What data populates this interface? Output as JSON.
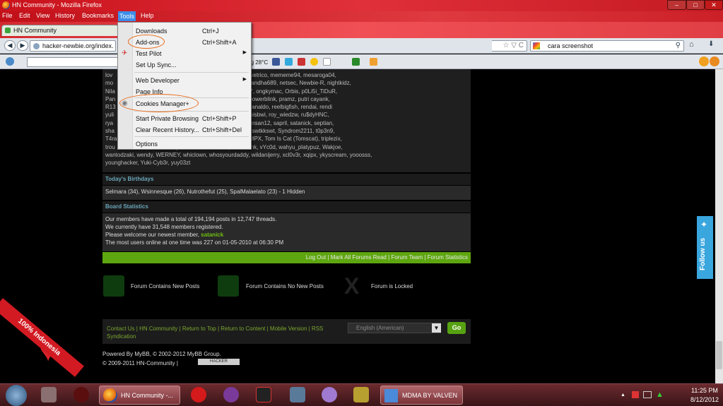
{
  "window": {
    "title": "HN Community - Mozilla Firefox",
    "min": "–",
    "max": "□",
    "close": "✕"
  },
  "menubar": [
    "File",
    "Edit",
    "View",
    "History",
    "Bookmarks",
    "Tools",
    "Help"
  ],
  "tab": {
    "label": "HN Community",
    "close": "×"
  },
  "navbar": {
    "back": "◀",
    "forward": "▶",
    "url": "hacker-newbie.org/index.",
    "star": "☆ ▽ C",
    "search_value": "cara screenshot",
    "search_icon": "search-icon"
  },
  "toolbar2": {
    "weather": "rang 28°C"
  },
  "tools_menu": {
    "items": [
      {
        "label": "Downloads",
        "shortcut": "Ctrl+J"
      },
      {
        "label": "Add-ons",
        "shortcut": "Ctrl+Shift+A"
      },
      {
        "label": "Test Pilot",
        "shortcut": ""
      },
      {
        "label": "Set Up Sync...",
        "shortcut": ""
      },
      {
        "label": "Web Developer",
        "shortcut": ""
      },
      {
        "label": "Page Info",
        "shortcut": ""
      },
      {
        "label": "Cookies Manager+",
        "shortcut": ""
      },
      {
        "label": "Start Private Browsing",
        "shortcut": "Ctrl+Shift+P"
      },
      {
        "label": "Clear Recent History...",
        "shortcut": "Ctrl+Shift+Del"
      },
      {
        "label": "Options",
        "shortcut": ""
      }
    ],
    "submenu_arrow": "▶"
  },
  "online_users": [
    "lov                                        3X, madnun, maknasetya, mavetrico, mememe94, mesaroga04,",
    "mo                                         _c0d3, N@wbie, nackkecil, Nandha689, netsec, Newbie-R, nightkidz,",
    "Nila                                       OB-PP, ochysudiqdo, oka1307, ongkymac, Orbis, p0Li5i_TiDuR,",
    "Pan                                ker, phiA, phikox, piuzz, plashtix, powerblink, pramz, putri cayank,",
    "R13                                       to, Random00, ravi, rawie, Reanaldo, reelbigfish, rendai, rendi",
    "yuli                                  cufky-XFL, rin.cruzer, RockSyd, roisbwi, roy_wiedzw, ru$dyHNC,",
    "rya                                   yuz4k1, SANG_KERINDUAN, Sansan12, sapril, satanick, septian,",
    "sha                                     oheLz, stronghold, SuperR00T, swtkkswt, Syndrom2211, t0p3n9,",
    "T4ra                                thedanielaaa95, TheGreenzzz, TMPX, Tom Is Cat (Tomscat), triplezix,",
    "trou                                  Virgin, volcalesia, vrobby46, vvtonk, vYc0d, wahyu_platypuz, Wakjoe,",
    "wantodzaki, wendy, WERNEY, whiclown, whosyourdaddy, wildanijerry, xcl0v3r, xqipx, ykyscream, yooosss,",
    "younghacker, Yuki-Cyb3r, yuy03zt"
  ],
  "birthdays": {
    "heading": "Today's Birthdays",
    "row": "Selmara (34), Wsinnesque (26), Nutrothefut (25), SpalMalaelato (23) - 1 Hidden"
  },
  "stats": {
    "heading": "Board Statistics",
    "line1": "Our members have made a total of 194,194 posts in 12,747 threads.",
    "line2": "We currently have 31,548 members registered.",
    "line3_prefix": "Please welcome our newest member, ",
    "line3_member": "satanick",
    "line4": "The most users online at one time was 227 on 01-05-2010 at 06:30 PM"
  },
  "footbar": "Log Out | Mark All Forums Read | Forum Team | Forum Statistics",
  "legend": {
    "new": "Forum Contains New Posts",
    "nonew": "Forum Contains No New Posts",
    "locked": "Forum is Locked"
  },
  "footer": {
    "links": "Contact Us | HN Community | Return to Top | Return to Content | Mobile Version | RSS Syndication",
    "lang": "English (American)",
    "go": "Go",
    "powered": "Powered By MyBB, © 2002-2012 MyBB Group.",
    "copy": "© 2009-2011 HN-Community |",
    "badge": "HACKER"
  },
  "ribbon": "100% Indonesia",
  "follow": "Follow us",
  "taskbar": {
    "task1": "HN Community -...",
    "task2": "MDMA BY VALVEN",
    "time": "11:25 PM",
    "date": "8/12/2012"
  },
  "colors": {
    "accent_green": "#6fbf12",
    "titlebar_red": "#c9121b",
    "annotation_orange": "#e86a18"
  }
}
